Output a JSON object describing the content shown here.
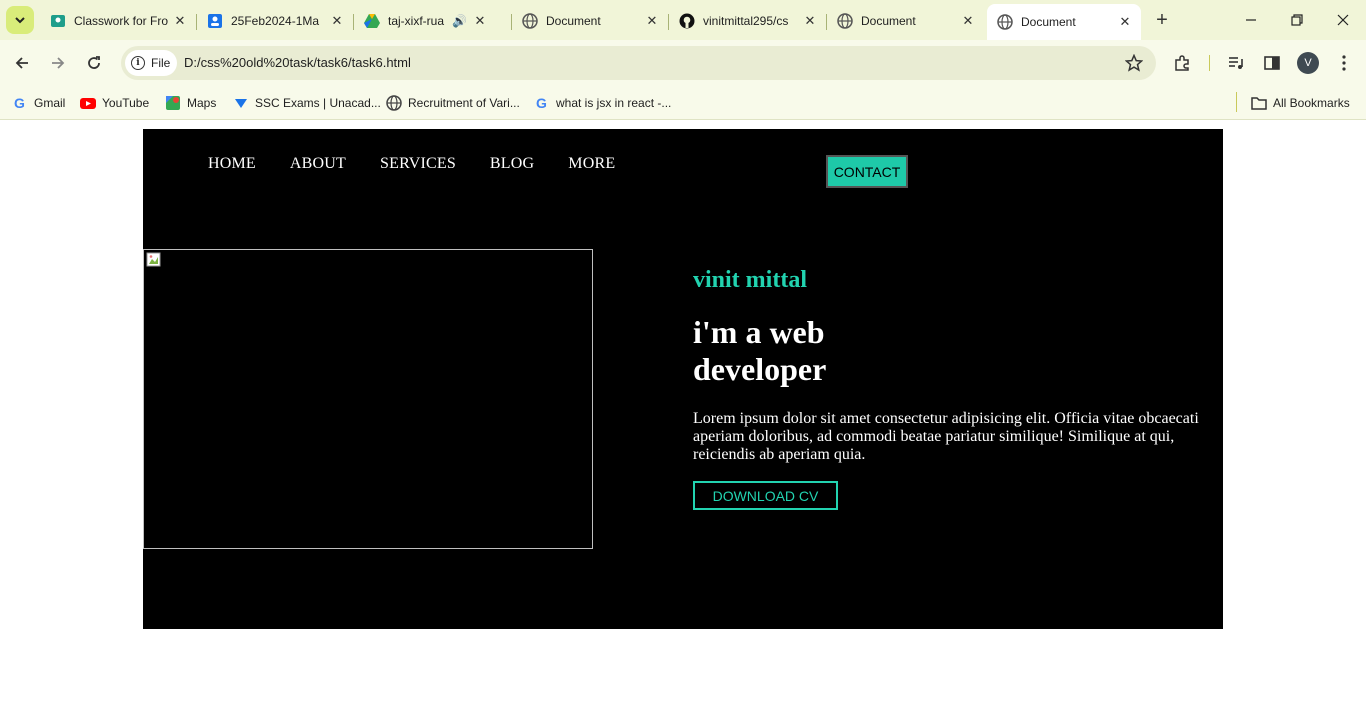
{
  "browser": {
    "tabs": [
      {
        "title": "Classwork for Fro",
        "icon": "classroom-icon",
        "active": false
      },
      {
        "title": "25Feb2024-1Ma",
        "icon": "user-account-icon",
        "active": false
      },
      {
        "title": "taj-xixf-rua (",
        "icon": "google-drive-icon",
        "active": false,
        "audio": true
      },
      {
        "title": "Document",
        "icon": "globe-icon",
        "active": false
      },
      {
        "title": "vinitmittal295/cs",
        "icon": "github-icon",
        "active": false
      },
      {
        "title": "Document",
        "icon": "globe-icon",
        "active": false
      },
      {
        "title": "Document",
        "icon": "globe-icon",
        "active": true
      }
    ],
    "chip_label": "File",
    "url": "D:/css%20old%20task/task6/task6.html",
    "avatar_letter": "V",
    "bookmarks": [
      {
        "label": "Gmail",
        "icon": "google-icon"
      },
      {
        "label": "YouTube",
        "icon": "youtube-icon"
      },
      {
        "label": "Maps",
        "icon": "maps-icon"
      },
      {
        "label": "SSC Exams | Unacad...",
        "icon": "unacademy-icon"
      },
      {
        "label": "Recruitment of Vari...",
        "icon": "globe-icon"
      },
      {
        "label": "what is jsx in react -...",
        "icon": "google-icon"
      }
    ],
    "all_bookmarks_label": "All Bookmarks"
  },
  "site": {
    "nav": [
      "HOME",
      "ABOUT",
      "SERVICES",
      "BLOG",
      "MORE"
    ],
    "contact_label": "CONTACT",
    "name": "vinit mittal",
    "headline": "i'm a web developer",
    "body": "Lorem ipsum dolor sit amet consectetur adipisicing elit. Officia vitae obcaecati aperiam doloribus, ad commodi beatae pariatur similique! Similique at qui, reiciendis ab aperiam quia.",
    "download_label": "DOWNLOAD CV"
  },
  "colors": {
    "accent": "#22d3b0",
    "page_bg": "#000000",
    "chrome_bg": "#f1f5d8"
  }
}
